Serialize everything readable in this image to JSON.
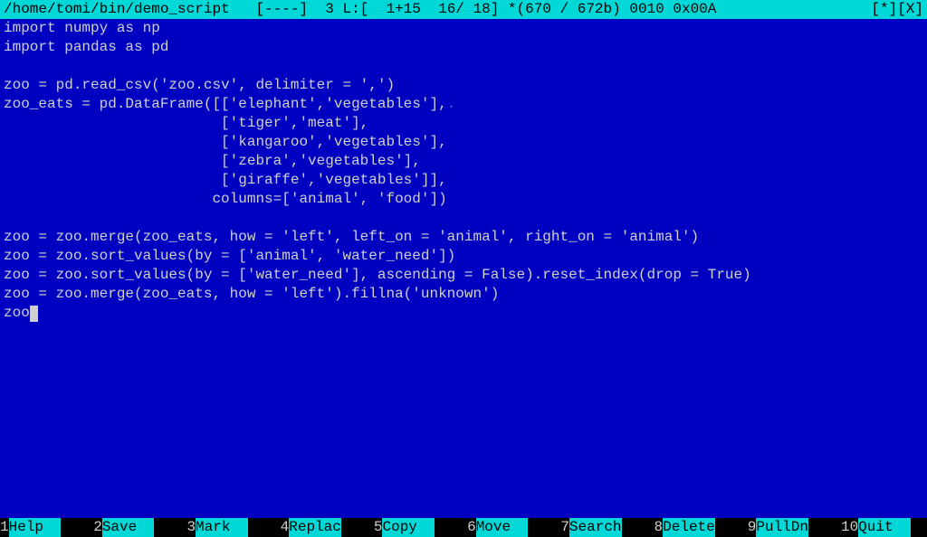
{
  "status_bar": {
    "path": "/home/tomi/bin/demo_script",
    "flags": "[----]",
    "line_info": "3 L:[  1+15  16/ 18]",
    "byte_info": "*(670 / 672b)",
    "cursor_pos": "0010",
    "char_hex": "0x00A",
    "modified_indicator": "[*]",
    "close_indicator": "[X]"
  },
  "code": {
    "lines": [
      "import numpy as np",
      "import pandas as pd",
      "",
      "zoo = pd.read_csv('zoo.csv', delimiter = ',')",
      "zoo_eats = pd.DataFrame([['elephant','vegetables'],",
      "                         ['tiger','meat'],",
      "                         ['kangaroo','vegetables'],",
      "                         ['zebra','vegetables'],",
      "                         ['giraffe','vegetables']],",
      "                        columns=['animal', 'food'])",
      "",
      "zoo = zoo.merge(zoo_eats, how = 'left', left_on = 'animal', right_on = 'animal')",
      "zoo = zoo.sort_values(by = ['animal', 'water_need'])",
      "zoo = zoo.sort_values(by = ['water_need'], ascending = False).reset_index(drop = True)",
      "zoo = zoo.merge(zoo_eats, how = 'left').fillna('unknown')",
      "zoo"
    ],
    "dot_line_index": 4,
    "cursor_line_index": 15
  },
  "function_keys": [
    {
      "num": "1",
      "label": "Help"
    },
    {
      "num": "2",
      "label": "Save"
    },
    {
      "num": "3",
      "label": "Mark"
    },
    {
      "num": "4",
      "label": "Replac"
    },
    {
      "num": "5",
      "label": "Copy"
    },
    {
      "num": "6",
      "label": "Move"
    },
    {
      "num": "7",
      "label": "Search"
    },
    {
      "num": "8",
      "label": "Delete"
    },
    {
      "num": "9",
      "label": "PullDn"
    },
    {
      "num": "10",
      "label": "Quit"
    }
  ]
}
